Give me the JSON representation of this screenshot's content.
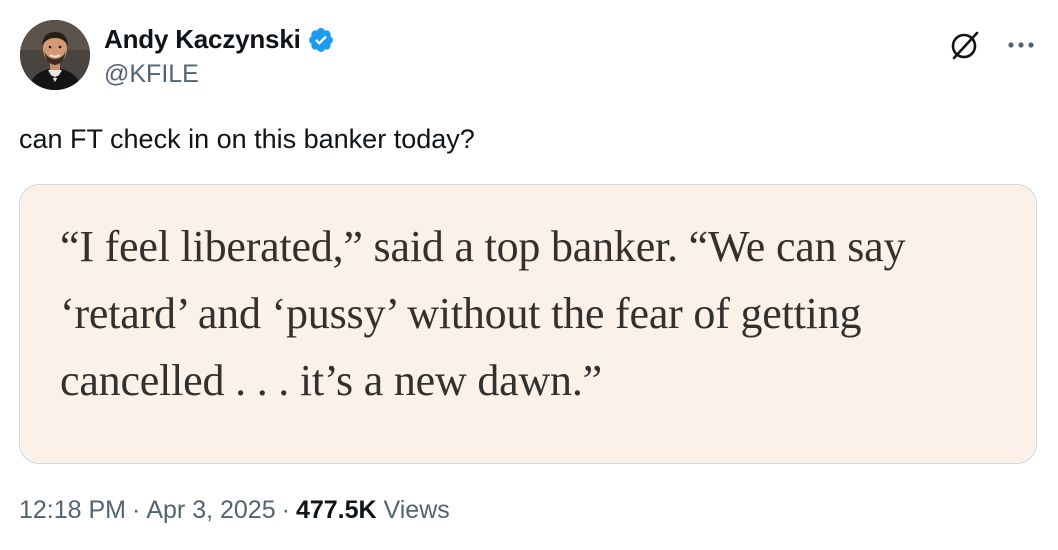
{
  "author": {
    "display_name": "Andy Kaczynski",
    "handle": "@KFILE",
    "verified_color": "#1d9bf0"
  },
  "tweet": {
    "text": "can FT check in on this banker today?"
  },
  "media": {
    "background": "#fbf1e8",
    "quote_lines": [
      "“I feel liberated,” said a top banker. “We can say",
      "‘retard’ and ‘pussy’ without the fear of getting",
      "cancelled . . . it’s a new dawn.”"
    ]
  },
  "meta": {
    "time": "12:18 PM",
    "separator": "·",
    "date": "Apr 3, 2025",
    "views_count": "477.5K",
    "views_label": "Views"
  },
  "icons": {
    "verified": "verified-badge-icon",
    "grok": "grok-icon",
    "more": "more-options-icon"
  }
}
